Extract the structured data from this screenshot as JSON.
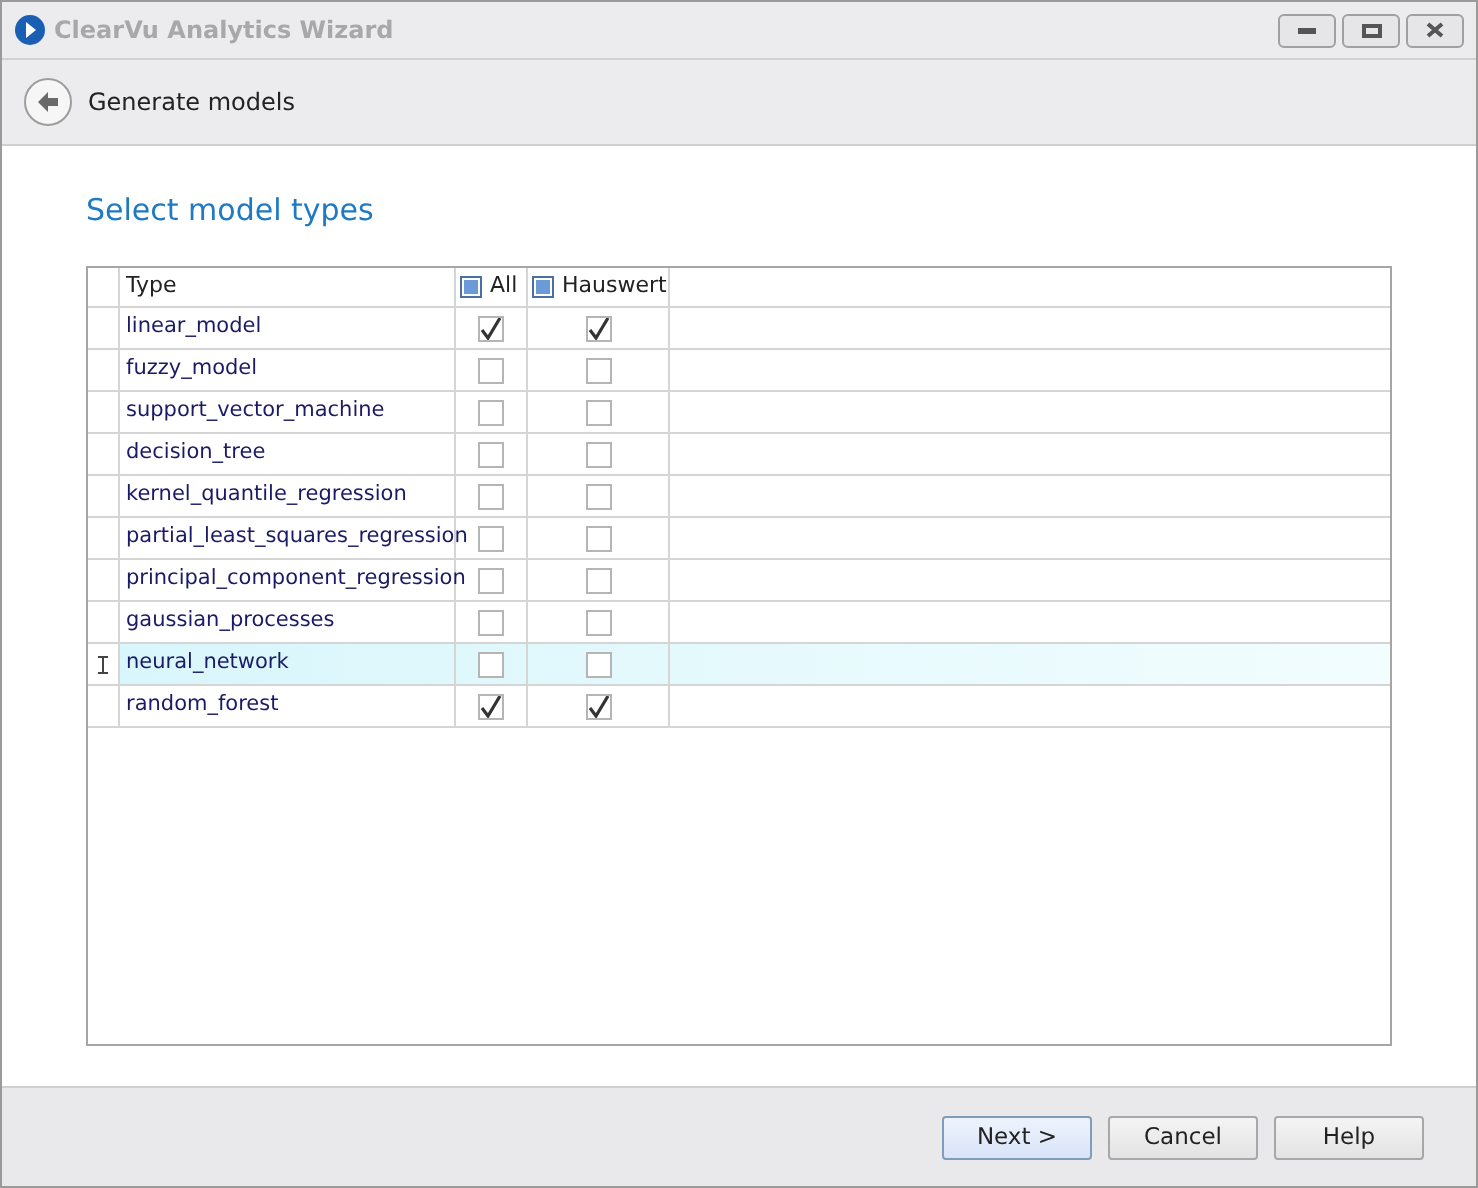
{
  "window": {
    "title": "ClearVu Analytics Wizard"
  },
  "header": {
    "title": "Generate models"
  },
  "section_title": "Select model types",
  "table": {
    "columns": [
      {
        "label": "Type"
      },
      {
        "label": "All",
        "indeterminate": true
      },
      {
        "label": "Hauswert",
        "indeterminate": true
      }
    ],
    "rows": [
      {
        "type": "linear_model",
        "all": true,
        "hauswert": true,
        "selected": false
      },
      {
        "type": "fuzzy_model",
        "all": false,
        "hauswert": false,
        "selected": false
      },
      {
        "type": "support_vector_machine",
        "all": false,
        "hauswert": false,
        "selected": false
      },
      {
        "type": "decision_tree",
        "all": false,
        "hauswert": false,
        "selected": false
      },
      {
        "type": "kernel_quantile_regression",
        "all": false,
        "hauswert": false,
        "selected": false
      },
      {
        "type": "partial_least_squares_regression",
        "all": false,
        "hauswert": false,
        "selected": false
      },
      {
        "type": "principal_component_regression",
        "all": false,
        "hauswert": false,
        "selected": false
      },
      {
        "type": "gaussian_processes",
        "all": false,
        "hauswert": false,
        "selected": false
      },
      {
        "type": "neural_network",
        "all": false,
        "hauswert": false,
        "selected": true
      },
      {
        "type": "random_forest",
        "all": true,
        "hauswert": true,
        "selected": false
      }
    ]
  },
  "buttons": [
    {
      "label": "Next >",
      "default": true
    },
    {
      "label": "Cancel",
      "default": false
    },
    {
      "label": "Help",
      "default": false
    }
  ]
}
